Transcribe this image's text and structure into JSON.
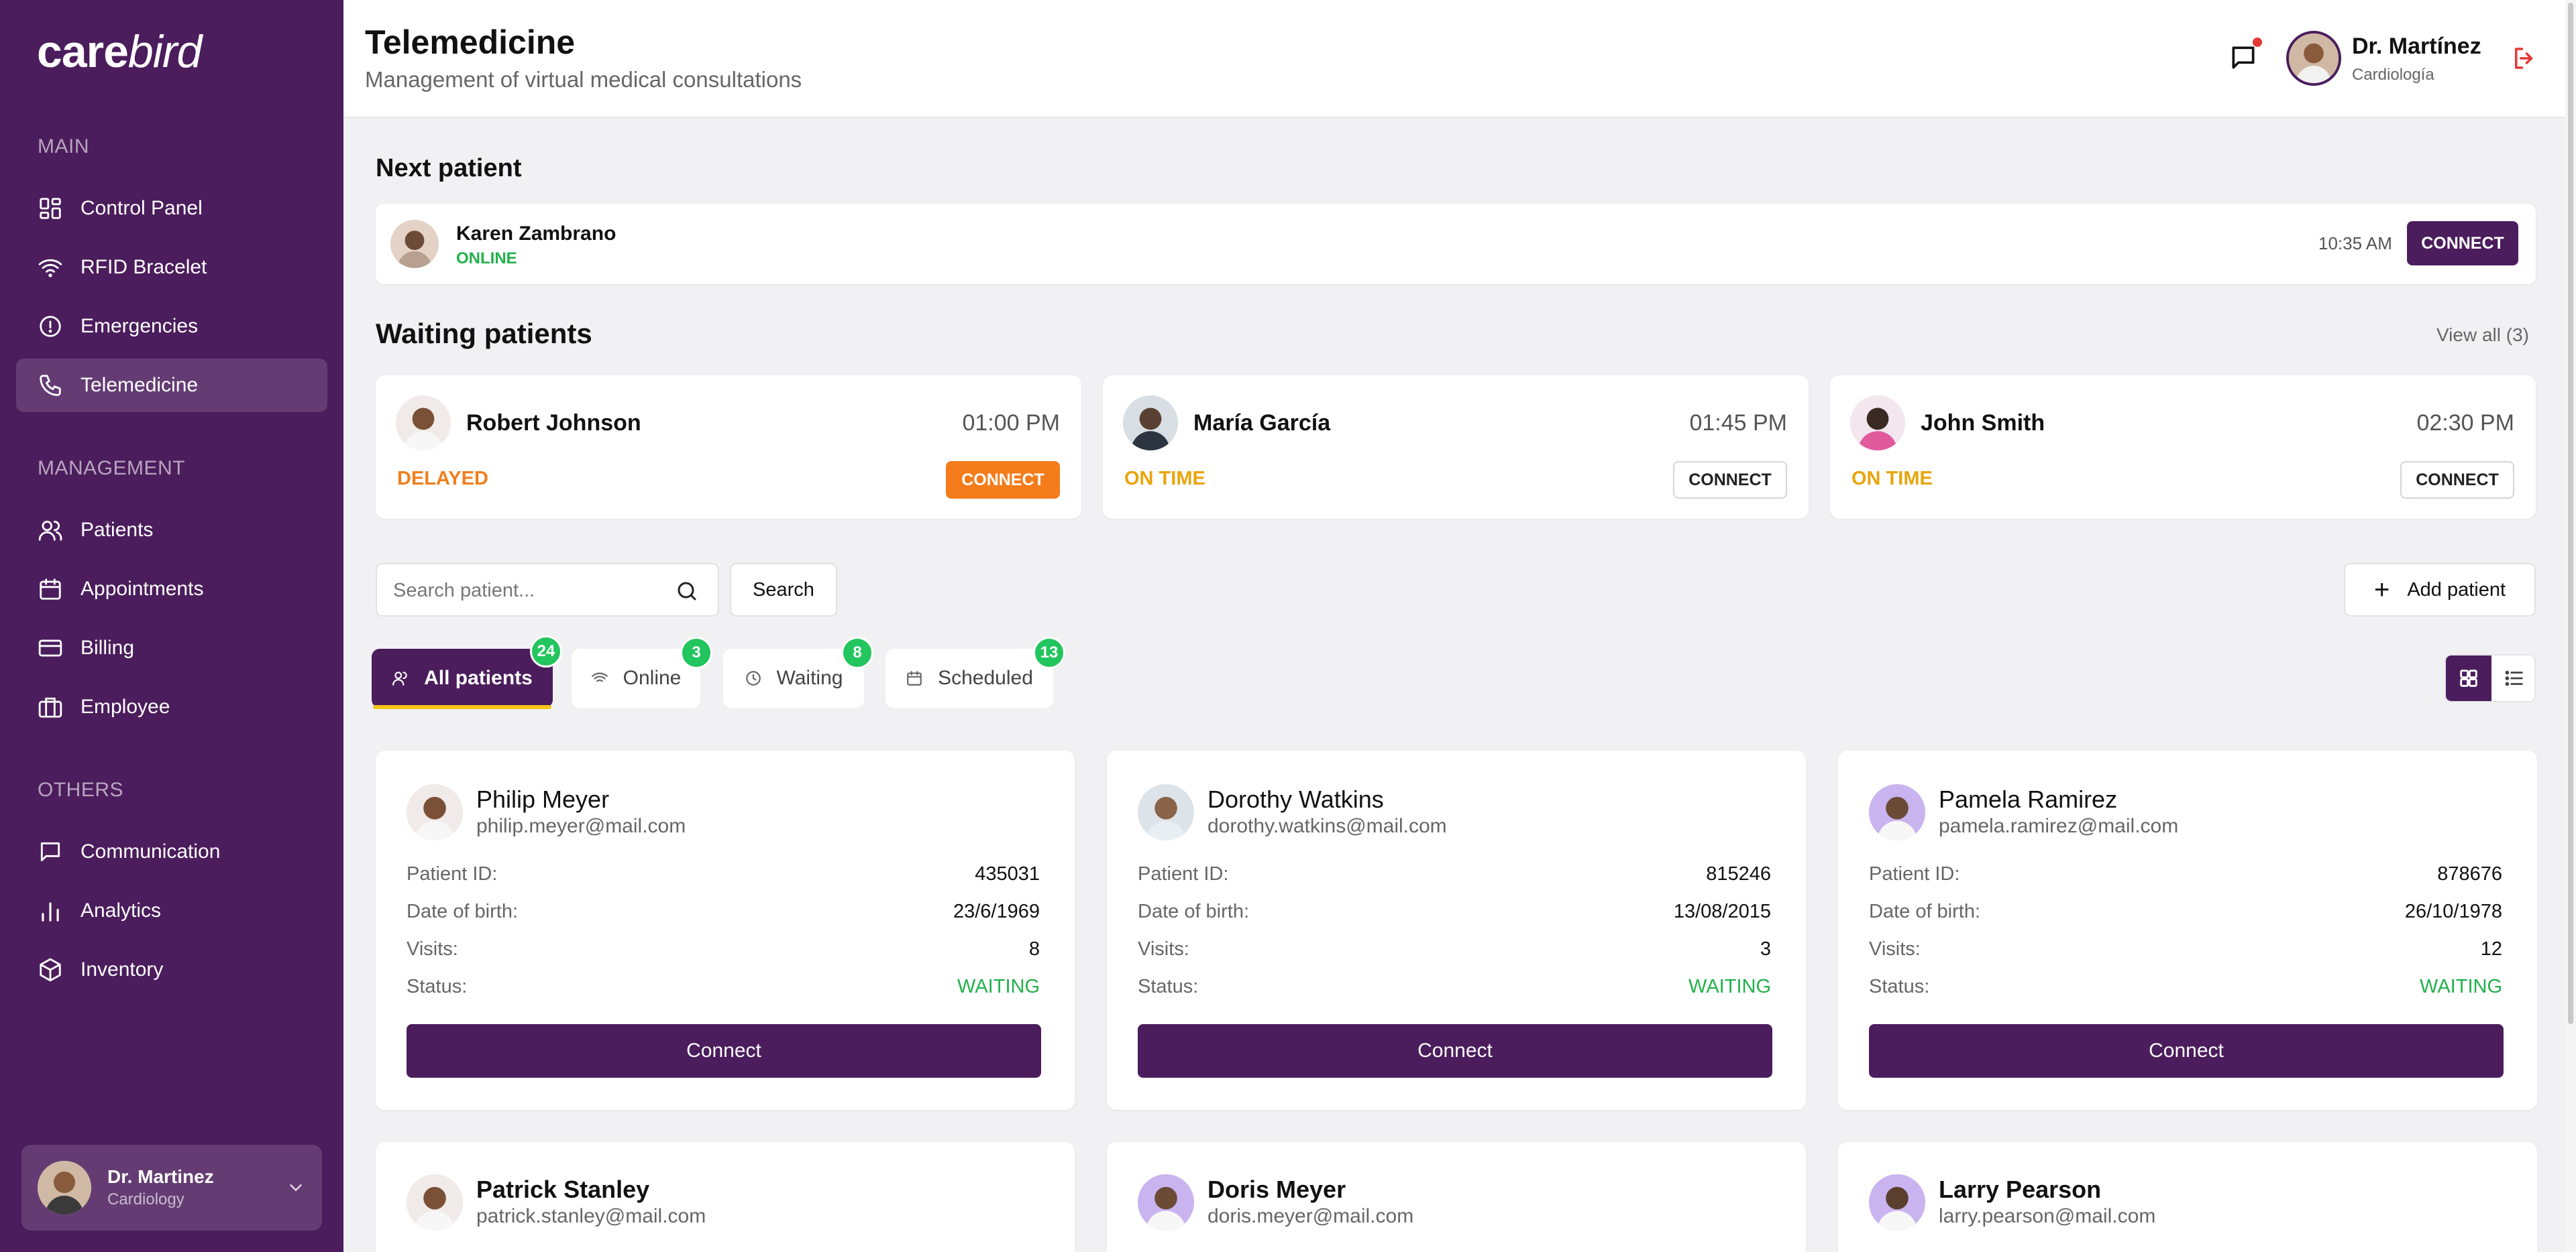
{
  "brand": {
    "logo_bold": "care",
    "logo_italic": "bird"
  },
  "sidebar": {
    "sections": [
      {
        "title": "MAIN",
        "items": [
          {
            "label": "Control Panel",
            "icon": "grid-icon"
          },
          {
            "label": "RFID Bracelet",
            "icon": "wifi-icon"
          },
          {
            "label": "Emergencies",
            "icon": "alert-circle-icon"
          },
          {
            "label": "Telemedicine",
            "icon": "phone-icon",
            "active": true
          }
        ]
      },
      {
        "title": "MANAGEMENT",
        "items": [
          {
            "label": "Patients",
            "icon": "users-icon"
          },
          {
            "label": "Appointments",
            "icon": "calendar-icon"
          },
          {
            "label": "Billing",
            "icon": "credit-card-icon"
          },
          {
            "label": "Employee",
            "icon": "briefcase-icon"
          }
        ]
      },
      {
        "title": "OTHERS",
        "items": [
          {
            "label": "Communication",
            "icon": "chat-icon"
          },
          {
            "label": "Analytics",
            "icon": "bar-chart-icon"
          },
          {
            "label": "Inventory",
            "icon": "box-icon"
          }
        ]
      }
    ],
    "user": {
      "name": "Dr. Martinez",
      "specialty": "Cardiology"
    }
  },
  "header": {
    "title": "Telemedicine",
    "subtitle": "Management of virtual medical consultations",
    "user_name": "Dr. Martínez",
    "user_specialty": "Cardiología"
  },
  "next_patient": {
    "heading": "Next patient",
    "name": "Karen Zambrano",
    "status": "ONLINE",
    "time": "10:35 AM",
    "button": "CONNECT"
  },
  "waiting": {
    "heading": "Waiting patients",
    "view_all": "View all (3)",
    "patients": [
      {
        "name": "Robert Johnson",
        "time": "01:00 PM",
        "status": "DELAYED",
        "status_color": "#f07f1e",
        "button": "CONNECT"
      },
      {
        "name": "María García",
        "time": "01:45 PM",
        "status": "ON TIME",
        "status_color": "#e8a50c",
        "button": "CONNECT"
      },
      {
        "name": "John Smith",
        "time": "02:30 PM",
        "status": "ON TIME",
        "status_color": "#e8a50c",
        "button": "CONNECT"
      }
    ]
  },
  "search": {
    "placeholder": "Search patient...",
    "button": "Search",
    "add_button": "Add patient"
  },
  "tabs": [
    {
      "label": "All patients",
      "count": "24",
      "icon": "users-icon"
    },
    {
      "label": "Online",
      "count": "3",
      "icon": "wifi-icon"
    },
    {
      "label": "Waiting",
      "count": "8",
      "icon": "clock-icon"
    },
    {
      "label": "Scheduled",
      "count": "13",
      "icon": "calendar-icon"
    }
  ],
  "labels": {
    "patient_id": "Patient ID:",
    "dob": "Date of birth:",
    "visits": "Visits:",
    "status": "Status:",
    "connect": "Connect"
  },
  "patients": [
    {
      "name": "Philip Meyer",
      "email": "philip.meyer@mail.com",
      "id": "435031",
      "dob": "23/6/1969",
      "visits": "8",
      "status": "WAITING"
    },
    {
      "name": "Dorothy Watkins",
      "email": "dorothy.watkins@mail.com",
      "id": "815246",
      "dob": "13/08/2015",
      "visits": "3",
      "status": "WAITING"
    },
    {
      "name": "Pamela Ramirez",
      "email": "pamela.ramirez@mail.com",
      "id": "878676",
      "dob": "26/10/1978",
      "visits": "12",
      "status": "WAITING"
    },
    {
      "name": "Patrick Stanley",
      "email": "patrick.stanley@mail.com"
    },
    {
      "name": "Doris Meyer",
      "email": "doris.meyer@mail.com"
    },
    {
      "name": "Larry Pearson",
      "email": "larry.pearson@mail.com"
    }
  ],
  "colors": {
    "brand": "#4b1d5c",
    "online": "#22b14c",
    "delayed": "#f07f1e",
    "badge": "#22c55e"
  }
}
